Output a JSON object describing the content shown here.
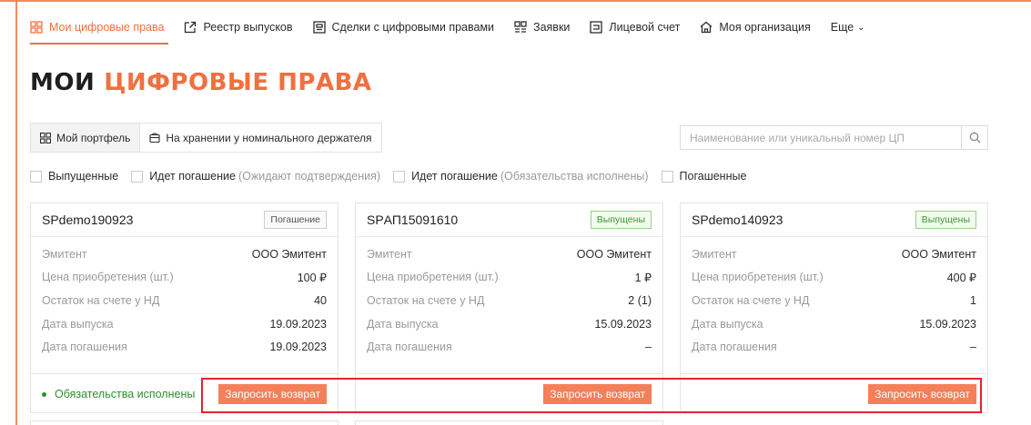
{
  "nav": {
    "items": [
      {
        "label": "Мои цифровые права",
        "icon": "grid-icon",
        "active": true
      },
      {
        "label": "Реестр выпусков",
        "icon": "edit-icon"
      },
      {
        "label": "Сделки с цифровыми правами",
        "icon": "deals-icon"
      },
      {
        "label": "Заявки",
        "icon": "requests-icon"
      },
      {
        "label": "Лицевой счет",
        "icon": "account-icon"
      },
      {
        "label": "Моя организация",
        "icon": "home-icon"
      }
    ],
    "more_label": "Еще"
  },
  "page": {
    "title_part1": "МОИ",
    "title_part2": "ЦИФРОВЫЕ ПРАВА"
  },
  "tabs": {
    "portfolio": "Мой портфель",
    "nominee": "На хранении у номинального держателя"
  },
  "search": {
    "placeholder": "Наименование или уникальный номер ЦП"
  },
  "filters": [
    {
      "label": "Выпущенные",
      "sub": ""
    },
    {
      "label": "Идет погашение",
      "sub": "(Ожидают подтверждения)"
    },
    {
      "label": "Идет погашение",
      "sub": "(Обязательства исполнены)"
    },
    {
      "label": "Погашенные",
      "sub": ""
    }
  ],
  "labels": {
    "issuer": "Эмитент",
    "price": "Цена приобретения (шт.)",
    "balance": "Остаток на счете у НД",
    "issue_date": "Дата выпуска",
    "redeem_date": "Дата погашения"
  },
  "cards": [
    {
      "name": "SPdemo190923",
      "badge": "Погашение",
      "issuer": "ООО Эмитент",
      "price": "100 ₽",
      "balance": "40",
      "issue_date": "19.09.2023",
      "redeem_date": "19.09.2023",
      "status": "Обязательства исполнены",
      "button": "Запросить возврат"
    },
    {
      "name": "SPАП15091610",
      "badge": "Выпущены",
      "issuer": "ООО Эмитент",
      "price": "1 ₽",
      "balance": "2 (1)",
      "issue_date": "15.09.2023",
      "redeem_date": "–",
      "status": "",
      "button": "Запросить возврат"
    },
    {
      "name": "SPdemo140923",
      "badge": "Выпущены",
      "issuer": "ООО Эмитент",
      "price": "400 ₽",
      "balance": "1",
      "issue_date": "15.09.2023",
      "redeem_date": "–",
      "status": "",
      "button": "Запросить возврат"
    }
  ],
  "colors": {
    "accent": "#f26f3f",
    "button": "#f4805a",
    "success": "#2f8f2f",
    "highlight": "#e0262a"
  }
}
